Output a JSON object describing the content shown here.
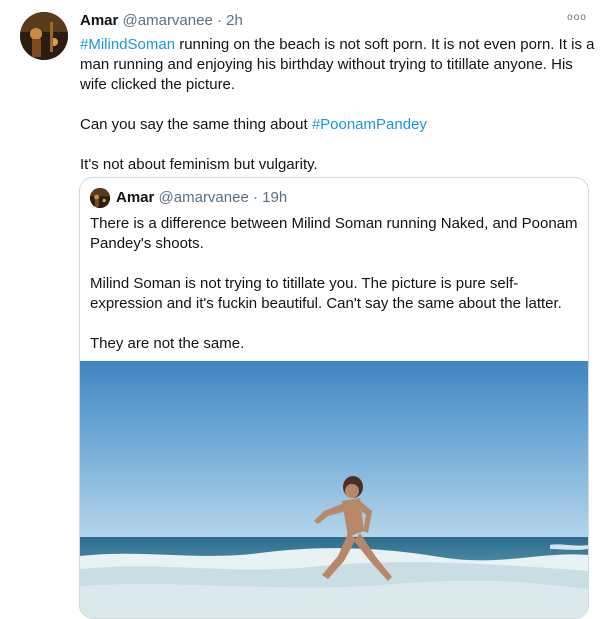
{
  "tweet": {
    "author_name": "Amar",
    "author_handle": "@amarvanee",
    "separator": "·",
    "time": "2h",
    "more_label": "ooo",
    "hashtag_1": "#MilindSoman",
    "line_1_rest": " running on the beach is not soft porn. It is not even porn. It is a man running and enjoying his birthday without trying to titillate anyone. His wife clicked the picture.",
    "line_2_prefix": "Can you say the same thing about ",
    "hashtag_2": "#PoonamPandey",
    "line_3": "It's not about feminism but vulgarity."
  },
  "quoted": {
    "author_name": "Amar",
    "author_handle": "@amarvanee",
    "separator": "·",
    "time": "19h",
    "para_1": "There is a difference between Milind Soman running Naked, and Poonam Pandey's shoots.",
    "para_2": "Milind Soman is not trying to titillate you. The picture is pure self-expression and it's fuckin beautiful. Can't say the same about the latter.",
    "para_3": "They are not the same."
  },
  "colors": {
    "link": "#1b95e0",
    "meta": "#5b7083",
    "border": "#cfd9de",
    "sky_top": "#3f86c2",
    "sky_bottom": "#a9cde6",
    "sea": "#2f6f8f"
  },
  "icons": {
    "more": "more-horizontal-icon"
  }
}
